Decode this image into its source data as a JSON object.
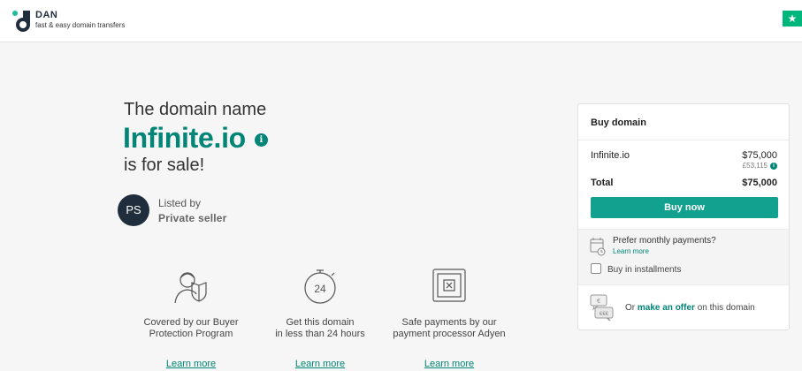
{
  "header": {
    "brand": "DAN",
    "tagline": "fast & easy domain transfers",
    "trust_icon": "star-icon"
  },
  "hero": {
    "line1": "The domain name",
    "domain": "Infinite.io",
    "line3": "is for sale!",
    "info_icon_glyph": "i"
  },
  "seller": {
    "initials": "PS",
    "listed_by": "Listed by",
    "name": "Private seller"
  },
  "features": [
    {
      "icon": "buyer-protection-icon",
      "line1": "Covered by our Buyer",
      "line2": "Protection Program",
      "link": "Learn more"
    },
    {
      "icon": "stopwatch-24-icon",
      "line1": "Get this domain",
      "line2": "in less than 24 hours",
      "link": "Learn more"
    },
    {
      "icon": "safe-payment-icon",
      "line1": "Safe payments by our",
      "line2": "payment processor Adyen",
      "link": "Learn more"
    }
  ],
  "buy_card": {
    "title": "Buy domain",
    "item_name": "Infinite.io",
    "item_price": "$75,000",
    "item_price_alt": "£53,115",
    "total_label": "Total",
    "total_price": "$75,000",
    "buy_button": "Buy now",
    "monthly_question": "Prefer monthly payments?",
    "monthly_link": "Learn more",
    "installments_label": "Buy in installments",
    "offer_prefix": "Or",
    "offer_link": "make an offer",
    "offer_suffix": "on this domain"
  },
  "colors": {
    "accent": "#008577",
    "button": "#12a08f",
    "avatar": "#1f2d3d",
    "trust": "#00b67a"
  }
}
